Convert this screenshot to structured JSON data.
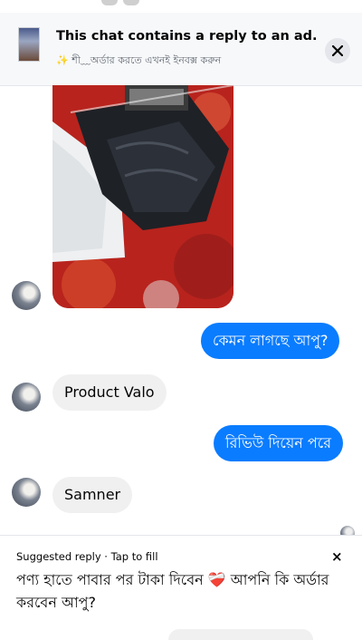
{
  "ad_banner": {
    "title": "This chat contains a reply to an ad.",
    "subtitle_emoji": "✨",
    "subtitle_text": "শী﹏অর্ডার করতে এখনই ইনবক্স করুন",
    "close_icon": "close-icon"
  },
  "messages": [
    {
      "direction": "outgoing",
      "text": "কেমন লাগছে আপু?"
    },
    {
      "direction": "incoming",
      "text": "Product Valo"
    },
    {
      "direction": "outgoing",
      "text": "রিভিউ দিয়েন পরে"
    },
    {
      "direction": "incoming",
      "text": "Samner"
    }
  ],
  "suggested_reply": {
    "label": "Suggested reply · Tap to fill",
    "text_part1": "পণ্য হাতে পাবার পর টাকা দিবেন",
    "emoji": "❤️‍🩹",
    "text_part2": "আপনি কি অর্ডার করবেন আপু?",
    "close_symbol": "×"
  },
  "colors": {
    "outgoing_bubble": "#0a7cff",
    "incoming_bubble": "#f0f0f0",
    "banner_bg": "#f7f8fa"
  }
}
